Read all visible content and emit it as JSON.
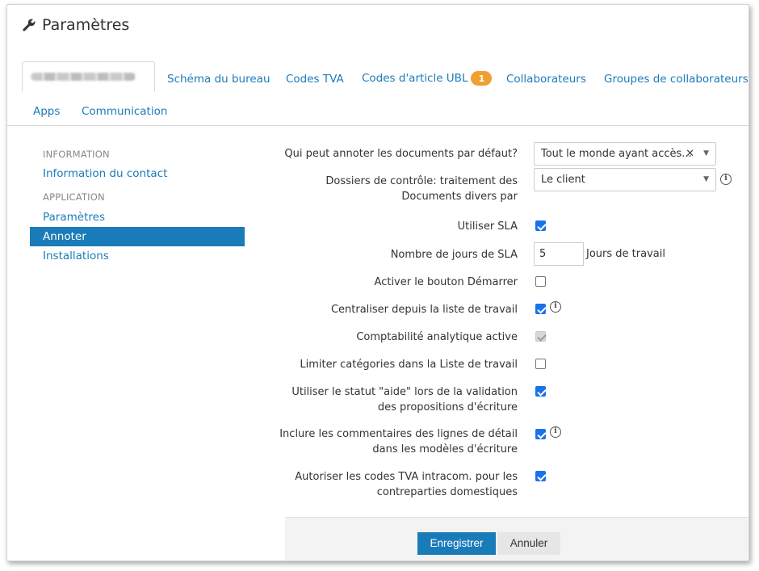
{
  "page": {
    "title": "Paramètres"
  },
  "tabs": [
    {
      "label": "",
      "active": true,
      "blurred": true
    },
    {
      "label": "Schéma du bureau"
    },
    {
      "label": "Codes TVA"
    },
    {
      "label": "Codes d'article UBL",
      "badge": "1"
    },
    {
      "label": "Collaborateurs"
    },
    {
      "label": "Groupes de collaborateurs"
    },
    {
      "label": "Apps"
    },
    {
      "label": "Communication"
    }
  ],
  "sidebar": {
    "section1": "INFORMATION",
    "contact": "Information du contact",
    "section2": "APPLICATION",
    "items": [
      "Paramètres",
      "Annoter",
      "Installations"
    ],
    "active_item": "Annoter"
  },
  "form": {
    "annotate_label": "Qui peut annoter les documents par défaut?",
    "annotate_value": "Tout le monde ayant accès...",
    "control_label_line1": "Dossiers de contrôle: traitement des",
    "control_label_line2": "Documents divers par",
    "control_value": "Le client",
    "sla_label": "Utiliser SLA",
    "sla_checked": true,
    "sla_days_label": "Nombre de jours de SLA",
    "sla_days_value": "5",
    "sla_days_suffix": "Jours de travail",
    "start_button_label": "Activer le bouton Démarrer",
    "start_button_checked": false,
    "centralize_label": "Centraliser depuis la liste de travail",
    "centralize_checked": true,
    "analytic_label": "Comptabilité analytique active",
    "analytic_checked": true,
    "limit_categories_label": "Limiter catégories dans la Liste de travail",
    "limit_categories_checked": false,
    "help_status_line1": "Utiliser le statut \"aide\" lors de la validation",
    "help_status_line2": "des propositions d'écriture",
    "help_status_checked": true,
    "comments_line1": "Inclure les commentaires des lignes de détail",
    "comments_line2": "dans les modèles d'écriture",
    "comments_checked": true,
    "vat_line1": "Autoriser les codes TVA intracom. pour les",
    "vat_line2": "contreparties domestiques",
    "vat_checked": true
  },
  "footer": {
    "save": "Enregistrer",
    "cancel": "Annuler"
  },
  "icons": {
    "title": "wrench-icon",
    "info": "info-icon",
    "clear": "close-icon",
    "dropdown": "chevron-down-icon"
  },
  "colors": {
    "accent": "#1a7bb9",
    "badge": "#f0a030",
    "checkbox": "#1a73e8"
  }
}
